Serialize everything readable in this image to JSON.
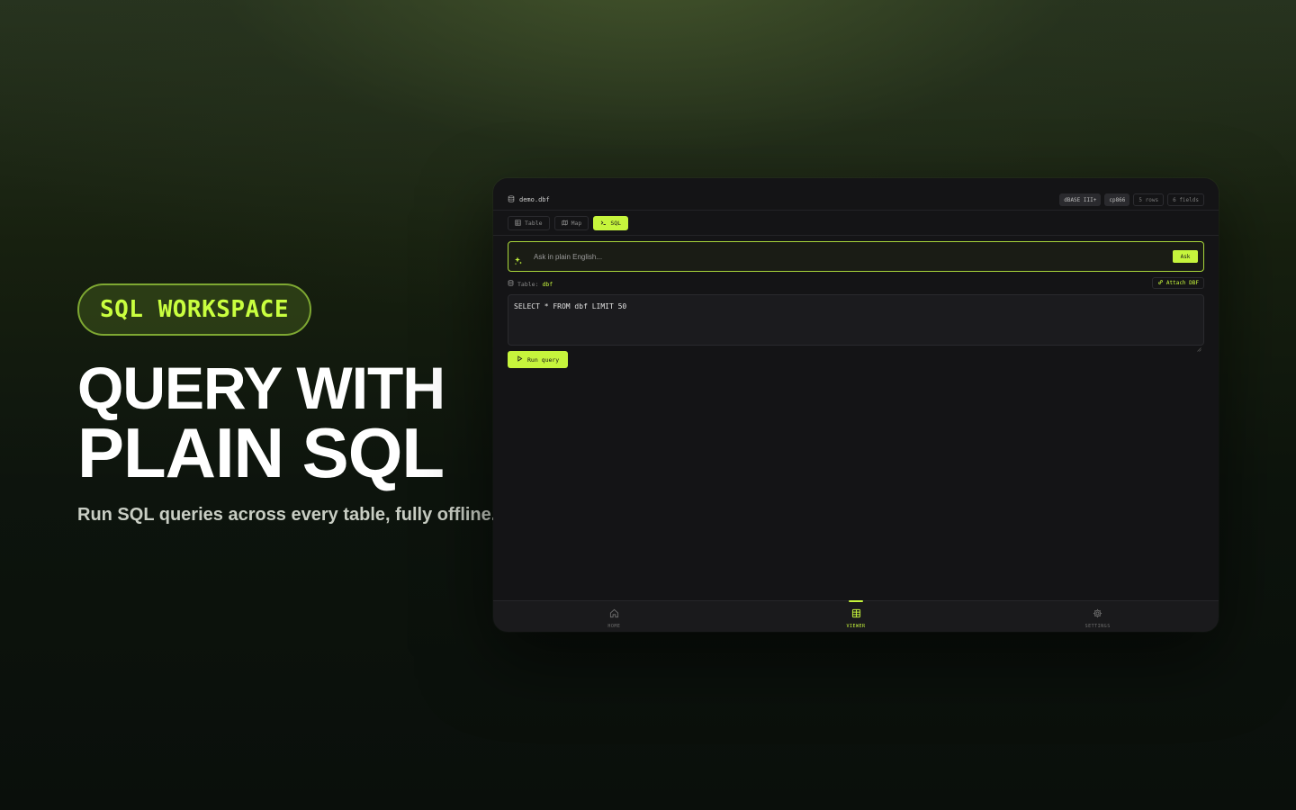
{
  "hero": {
    "badge": "SQL WORKSPACE",
    "headline_line1": "QUERY WITH",
    "headline_line2": "PLAIN SQL",
    "subline": "Run SQL queries across every table, fully offline."
  },
  "app": {
    "file_name": "demo.dbf",
    "meta_badges": [
      "dBASE III+",
      "cp866",
      "5 rows",
      "6 fields"
    ],
    "tabs": [
      {
        "label": "Table",
        "icon": "grid-icon",
        "active": false
      },
      {
        "label": "Map",
        "icon": "map-icon",
        "active": false
      },
      {
        "label": "SQL",
        "icon": "terminal-icon",
        "active": true
      }
    ],
    "ask": {
      "placeholder": "Ask in plain English...",
      "button_label": "Ask",
      "icon": "sparkle-icon"
    },
    "table_prefix": "Table:",
    "table_name": "dbf",
    "attach_label": "Attach DBF",
    "sql_query": "SELECT * FROM dbf LIMIT 50",
    "run_label": "Run query",
    "nav": [
      {
        "label": "HOME",
        "icon": "home-icon",
        "active": false
      },
      {
        "label": "VIEWER",
        "icon": "table-icon",
        "active": true
      },
      {
        "label": "SETTINGS",
        "icon": "gear-icon",
        "active": false
      }
    ],
    "colors": {
      "accent": "#c6f53c",
      "background": "#141416",
      "border": "#2a2a2e"
    }
  }
}
